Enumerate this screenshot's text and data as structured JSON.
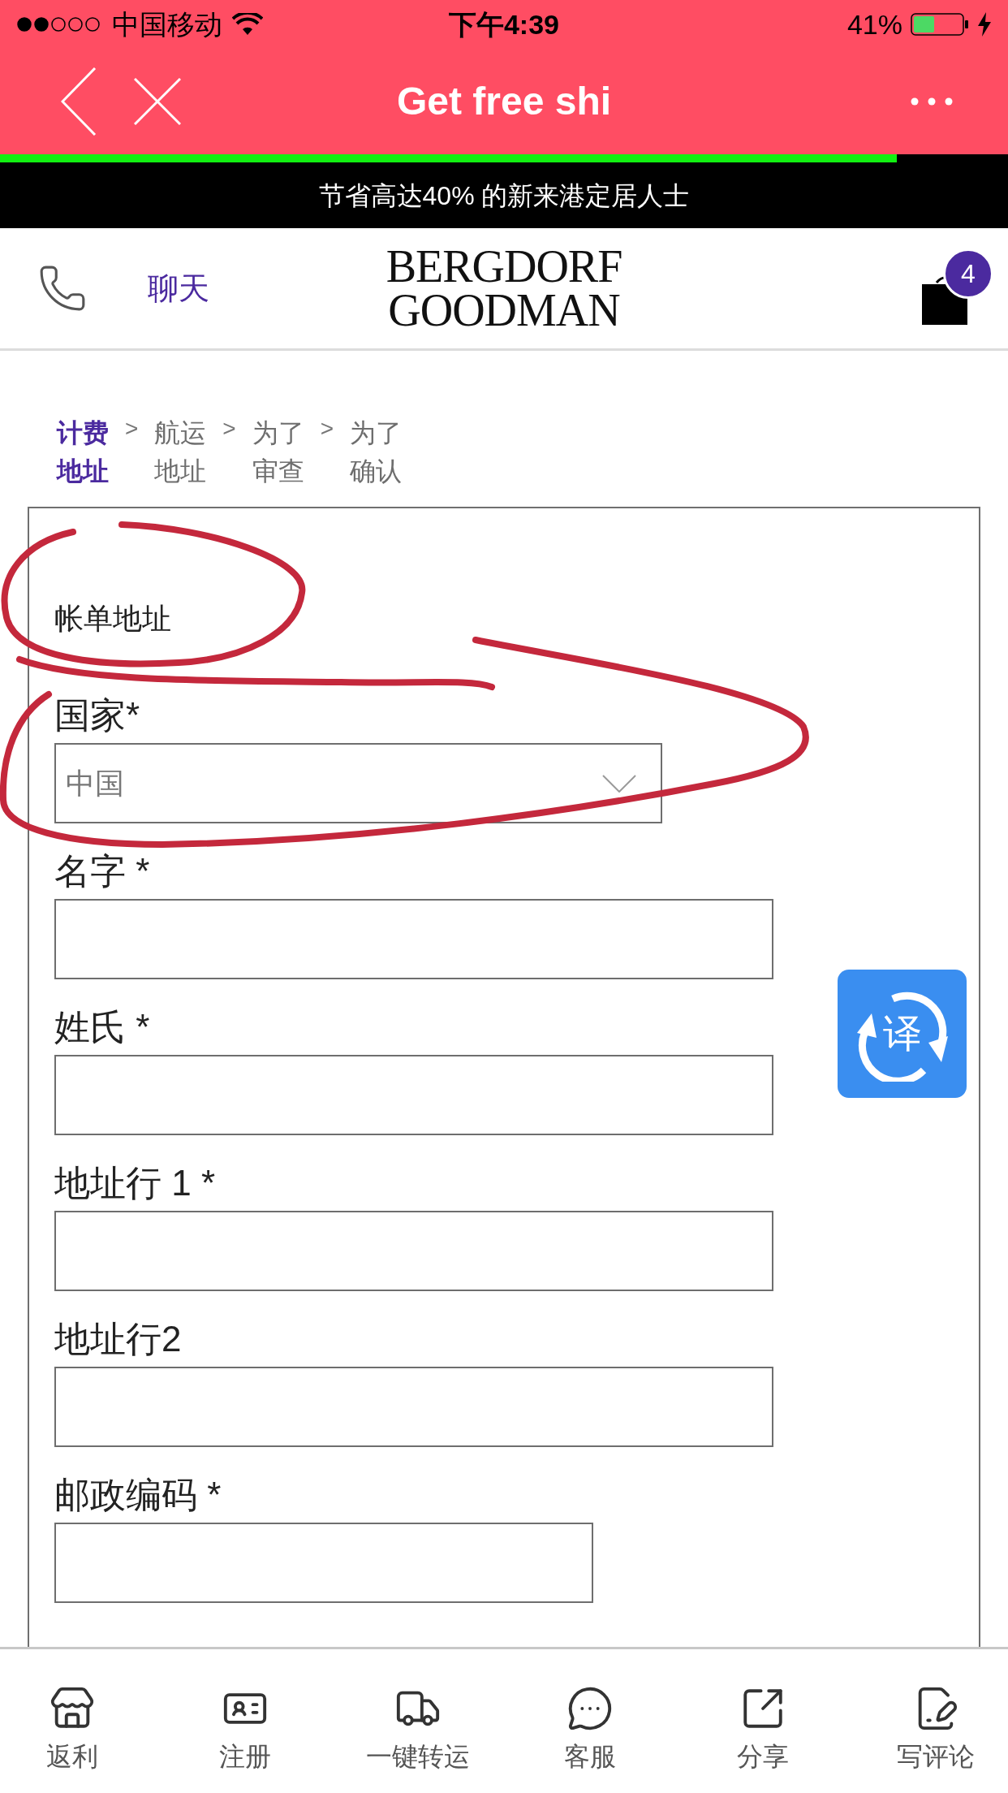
{
  "status_bar": {
    "carrier": "中国移动",
    "time": "下午4:39",
    "battery": "41%"
  },
  "nav_bar": {
    "title": "Get free shi",
    "load_progress": {
      "level": 0.89
    }
  },
  "promo_banner": {
    "text": "节省高达40% 的新来港定居人士"
  },
  "header": {
    "chat_link": "聊天",
    "logo": [
      "BERGDORF",
      "GOODMAN"
    ],
    "cart_badge": "4"
  },
  "checkout_steps": [
    {
      "lines": [
        "计费",
        "地址"
      ],
      "selected": true
    },
    {
      "separator": ">",
      "lines": [
        "航运",
        "地址"
      ],
      "selected": false
    },
    {
      "separator": ">",
      "lines": [
        "为了",
        "审查"
      ],
      "selected": false
    },
    {
      "separator": ">",
      "lines": [
        "为了",
        "确认"
      ],
      "selected": false
    }
  ],
  "billing_form": {
    "title": "帐单地址",
    "fields": [
      {
        "kind": "select",
        "label": "国家*",
        "value": "中国"
      },
      {
        "kind": "text",
        "label": "名字 *"
      },
      {
        "kind": "text",
        "label": "姓氏 *"
      },
      {
        "kind": "text",
        "label": "地址行 1 *"
      },
      {
        "kind": "text",
        "label": "地址行2"
      },
      {
        "kind": "short_text",
        "label": "邮政编码 *"
      }
    ]
  },
  "translate_button": {
    "label": "译"
  },
  "bottom_tabs": [
    {
      "label": "返利"
    },
    {
      "label": "注册"
    },
    {
      "label": "一键转运"
    },
    {
      "label": "客服"
    },
    {
      "label": "分享"
    },
    {
      "label": "写评论"
    }
  ]
}
